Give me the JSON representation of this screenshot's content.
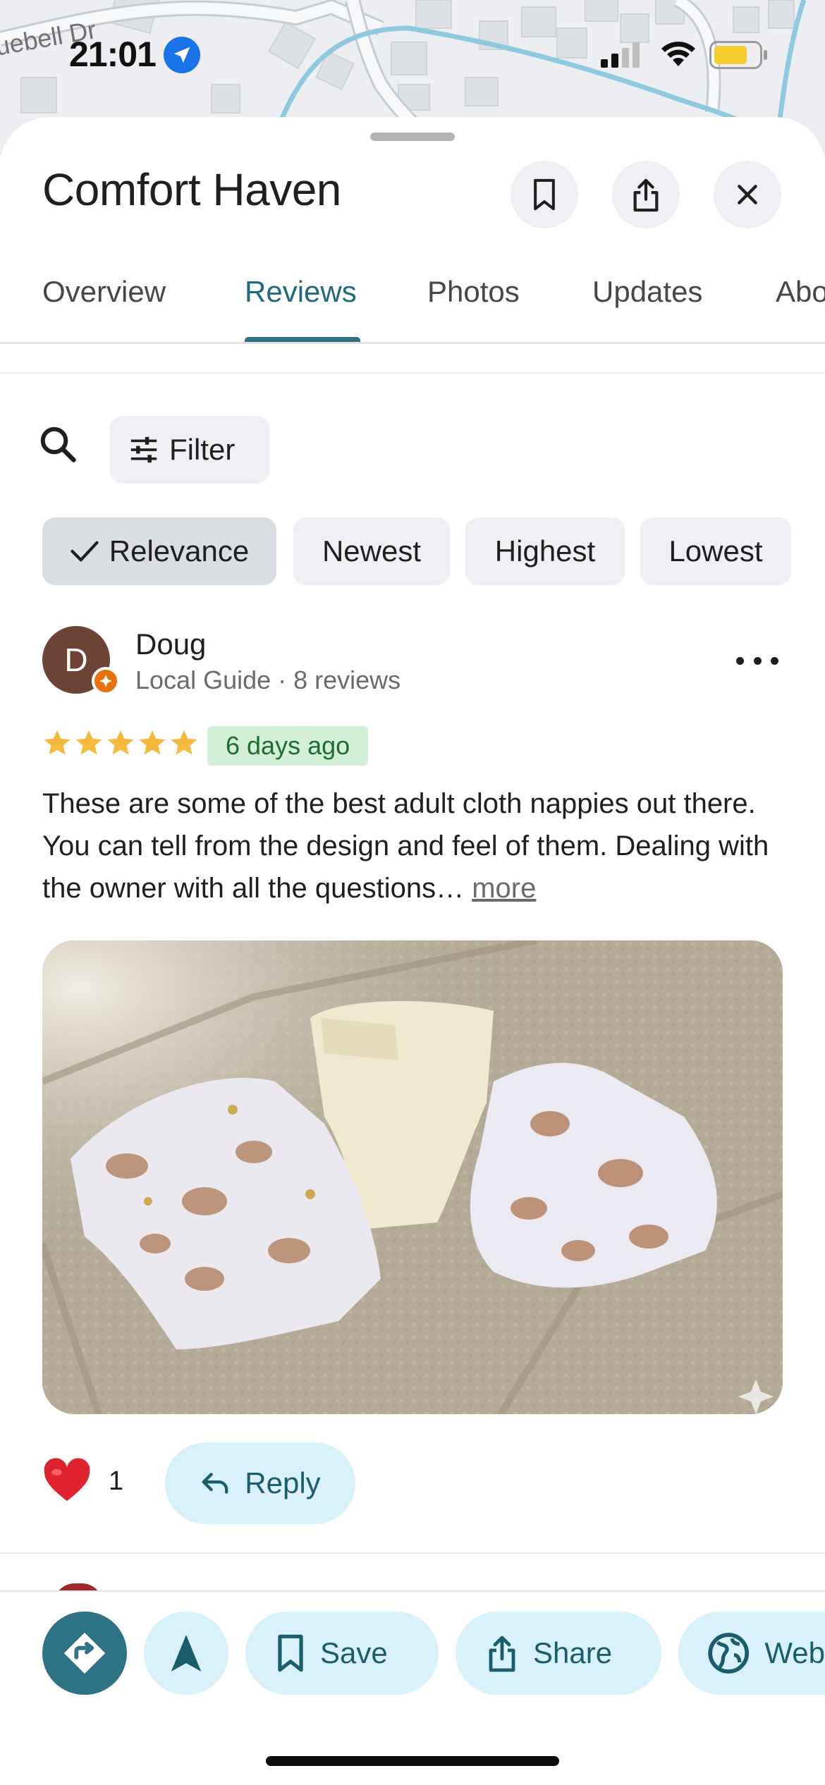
{
  "status_bar": {
    "time": "21:01",
    "map_street_label": "uebell Dr"
  },
  "place": {
    "title": "Comfort Haven"
  },
  "header_buttons": {
    "save_icon": "bookmark-icon",
    "share_icon": "share-icon",
    "close_icon": "close-icon"
  },
  "tabs": [
    {
      "label": "Overview"
    },
    {
      "label": "Reviews"
    },
    {
      "label": "Photos"
    },
    {
      "label": "Updates"
    },
    {
      "label": "Abo"
    }
  ],
  "active_tab": "Reviews",
  "filter": {
    "label": "Filter"
  },
  "sort_chips": [
    {
      "label": "Relevance",
      "selected": true
    },
    {
      "label": "Newest"
    },
    {
      "label": "Highest"
    },
    {
      "label": "Lowest"
    }
  ],
  "review": {
    "avatar_initial": "D",
    "author": "Doug",
    "meta": "Local Guide · 8 reviews",
    "rating": 5,
    "date": "6 days ago",
    "text": "These are some of the best adult cloth nappies out there. You can tell from the design and feel of them. Dealing with the owner with all the questions…",
    "more_label": "more",
    "likes": "1",
    "reply_label": "Reply"
  },
  "action_bar": {
    "save_label": "Save",
    "share_label": "Share",
    "website_label": "Web"
  },
  "colors": {
    "accent": "#2e7386",
    "chip_bg": "#eef0f3",
    "action_bg": "#d8f1fb",
    "star": "#f6b93b",
    "date_badge_bg": "#d4efd8"
  }
}
